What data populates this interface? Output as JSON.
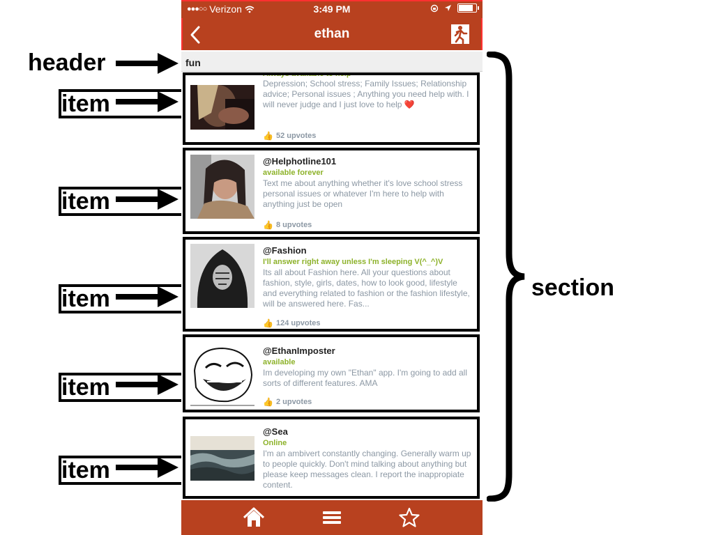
{
  "annotations": {
    "header_label": "header",
    "item_label": "item",
    "section_label": "section"
  },
  "status_bar": {
    "signal_dots": "●●●○○",
    "carrier": "Verizon",
    "time": "3:49 PM"
  },
  "nav": {
    "title": "ethan"
  },
  "section": {
    "header": "fun"
  },
  "items": [
    {
      "handle": "",
      "status": "Always available to help",
      "description": "Depression; School stress; Family Issues; Relationship advice; Personal issues ;  Anything you need help with. I will never judge and I just love to help ❤️",
      "upvotes": "52 upvotes"
    },
    {
      "handle": "@Helphotline101",
      "status": "available forever",
      "description": "Text me about anything whether it's love school stress personal issues or whatever I'm here to help with anything just be open",
      "upvotes": "8 upvotes"
    },
    {
      "handle": "@Fashion",
      "status": "I'll answer right away unless I'm sleeping V(^_^)V",
      "description": "Its all about Fashion here. All your questions about fashion, style, girls, dates, how to look good, lifestyle and everything related to fashion or the fashion lifestyle, will be answered here. Fas...",
      "upvotes": "124 upvotes"
    },
    {
      "handle": "@EthanImposter",
      "status": "available",
      "description": "Im developing my own \"Ethan\" app.  I'm going to add all sorts of different features. AMA",
      "upvotes": "2 upvotes"
    },
    {
      "handle": "@Sea",
      "status": "Online",
      "description": "I'm an ambivert constantly changing. Generally warm up to people quickly. Don't mind talking about anything but please keep messages clean. I report the inappropiate content.",
      "upvotes": ""
    }
  ],
  "tabs": [
    "home-icon",
    "menu-icon",
    "star-icon"
  ],
  "colors": {
    "brand": "#b8411f",
    "status_green": "#8db22a",
    "desc_gray": "#8c98a4"
  }
}
